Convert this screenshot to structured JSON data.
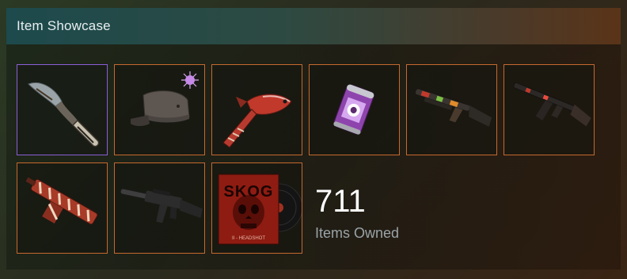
{
  "showcase": {
    "title": "Item Showcase",
    "items_owned_count": "711",
    "items_owned_label": "Items Owned",
    "slots": [
      {
        "icon": "knife-icon",
        "border_color": "#8a5fd6"
      },
      {
        "icon": "cap-icon",
        "border_color": "#c5692e"
      },
      {
        "icon": "fish-icon",
        "border_color": "#c5692e"
      },
      {
        "icon": "soda-can-icon",
        "border_color": "#c5692e"
      },
      {
        "icon": "shotgun-icon",
        "border_color": "#c5692e"
      },
      {
        "icon": "rifle-icon",
        "border_color": "#c5692e"
      },
      {
        "icon": "machine-gun-icon",
        "border_color": "#c5692e"
      },
      {
        "icon": "assault-rifle-icon",
        "border_color": "#c5692e"
      },
      {
        "icon": "music-kit-icon",
        "border_color": "#c5692e"
      }
    ],
    "music_kit": {
      "brand": "SKOG",
      "subtitle": "II - HEADSHOT"
    }
  }
}
